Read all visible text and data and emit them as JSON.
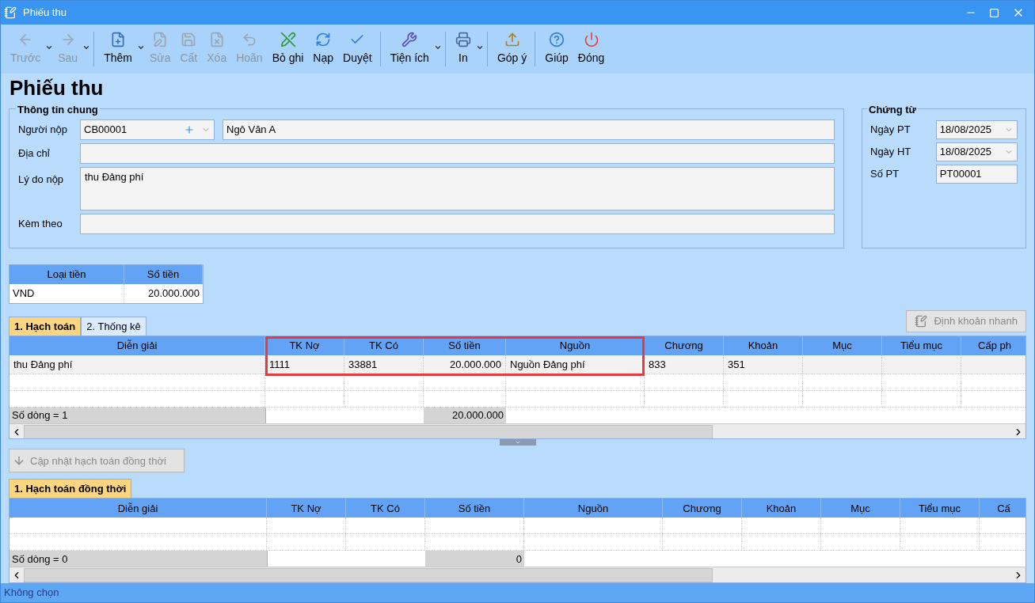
{
  "window": {
    "title": "Phiếu thu"
  },
  "toolbar": {
    "groups": [
      [
        {
          "label": "Trước",
          "disabled": true,
          "dropdown": true
        },
        {
          "label": "Sau",
          "disabled": true,
          "dropdown": true
        }
      ],
      [
        {
          "label": "Thêm",
          "disabled": false,
          "dropdown": true
        },
        {
          "label": "Sửa",
          "disabled": true,
          "dropdown": false
        },
        {
          "label": "Cất",
          "disabled": true,
          "dropdown": false
        },
        {
          "label": "Xóa",
          "disabled": true,
          "dropdown": false
        },
        {
          "label": "Hoãn",
          "disabled": true,
          "dropdown": false
        },
        {
          "label": "Bỏ ghi",
          "disabled": false,
          "dropdown": false
        },
        {
          "label": "Nạp",
          "disabled": false,
          "dropdown": false
        },
        {
          "label": "Duyệt",
          "disabled": false,
          "dropdown": false
        }
      ],
      [
        {
          "label": "Tiện ích",
          "disabled": false,
          "dropdown": true
        }
      ],
      [
        {
          "label": "In",
          "disabled": false,
          "dropdown": true
        }
      ],
      [
        {
          "label": "Góp ý",
          "disabled": false,
          "dropdown": false
        }
      ],
      [
        {
          "label": "Giúp",
          "disabled": false,
          "dropdown": false
        },
        {
          "label": "Đóng",
          "disabled": false,
          "dropdown": false
        }
      ]
    ]
  },
  "heading": "Phiếu thu",
  "general": {
    "title": "Thông tin chung",
    "payer": {
      "label": "Người nộp",
      "code": "CB00001",
      "name": "Ngô Văn A"
    },
    "address": {
      "label": "Địa chỉ"
    },
    "reason": {
      "label": "Lý do nộp",
      "value": "thu Đảng phí"
    },
    "attachment": {
      "label": "Kèm theo"
    }
  },
  "voucher": {
    "title": "Chứng từ",
    "fields": [
      {
        "label": "Ngày PT",
        "value": "18/08/2025",
        "kind": "date"
      },
      {
        "label": "Ngày HT",
        "value": "18/08/2025",
        "kind": "date"
      },
      {
        "label": "Số PT",
        "value": "PT00001",
        "kind": "text"
      }
    ]
  },
  "currency": {
    "columns": [
      "Loại tiền",
      "Số tiền"
    ],
    "row": [
      "VND",
      "20.000.000"
    ]
  },
  "tabs": [
    {
      "label": "1. Hạch toán",
      "selected": true
    },
    {
      "label": "2. Thống kê",
      "selected": false
    }
  ],
  "quick_entry_button": "Định khoản nhanh",
  "grid": {
    "columns": [
      {
        "label": "Diễn giải",
        "highlighted": false
      },
      {
        "label": "TK Nợ",
        "highlighted": true
      },
      {
        "label": "TK Có",
        "highlighted": true
      },
      {
        "label": "Số tiền",
        "highlighted": true
      },
      {
        "label": "Nguồn",
        "highlighted": true
      },
      {
        "label": "Chương",
        "highlighted": false
      },
      {
        "label": "Khoản",
        "highlighted": false
      },
      {
        "label": "Mục",
        "highlighted": false
      },
      {
        "label": "Tiểu mục",
        "highlighted": false
      },
      {
        "label": "Cấp ph",
        "highlighted": false
      }
    ],
    "rows": [
      [
        "thu Đảng phí",
        "1111",
        "33881",
        "20.000.000",
        "Nguồn Đảng phí",
        "833",
        "351",
        "",
        "",
        ""
      ]
    ],
    "footer": {
      "count": "Số dòng = 1",
      "total": "20.000.000"
    }
  },
  "update_button": "Cập nhật hạch toán đồng thời",
  "tabs2": [
    {
      "label": "1. Hạch toán đồng thời",
      "selected": true
    }
  ],
  "grid2": {
    "columns": [
      {
        "label": "Diễn giải"
      },
      {
        "label": "TK Nợ"
      },
      {
        "label": "TK Có"
      },
      {
        "label": "Số tiền"
      },
      {
        "label": "Nguồn"
      },
      {
        "label": "Chương"
      },
      {
        "label": "Khoản"
      },
      {
        "label": "Mục"
      },
      {
        "label": "Tiểu mục"
      },
      {
        "label": "Cấ"
      }
    ],
    "footer": {
      "count": "Số dòng = 0",
      "total": "0"
    }
  },
  "status_bar": "Không chọn"
}
